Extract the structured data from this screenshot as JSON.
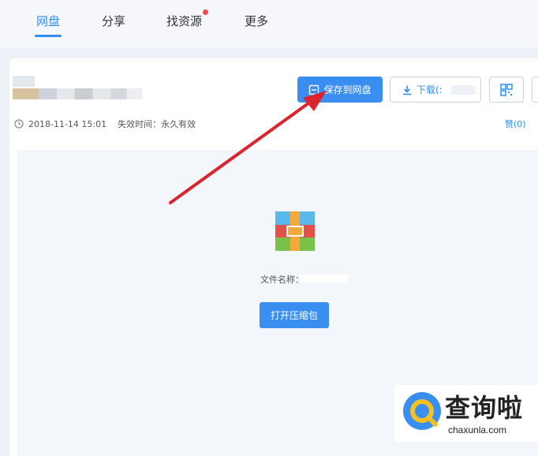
{
  "nav": {
    "tabs": [
      {
        "label": "网盘",
        "active": true
      },
      {
        "label": "分享",
        "active": false
      },
      {
        "label": "找资源",
        "active": false,
        "badge": true
      },
      {
        "label": "更多",
        "active": false
      }
    ]
  },
  "toolbar": {
    "save_label": "保存到网盘",
    "download_label": "下载(:",
    "download_suffix": "",
    "save_icon": "save-icon",
    "download_icon": "download-icon",
    "qr_icon": "qr-code-icon"
  },
  "meta": {
    "date": "2018-11-14 15:01",
    "expire": "失效时间：永久有效",
    "like": "赞(0)"
  },
  "preview": {
    "filename": "文件名称：",
    "open_label": "打开压缩包"
  },
  "watermark": {
    "title": "查询啦",
    "url": "chaxunla.com"
  },
  "colors": {
    "accent": "#3a8ef0",
    "arrow": "#d9262e",
    "badge": "#f24b4b"
  }
}
